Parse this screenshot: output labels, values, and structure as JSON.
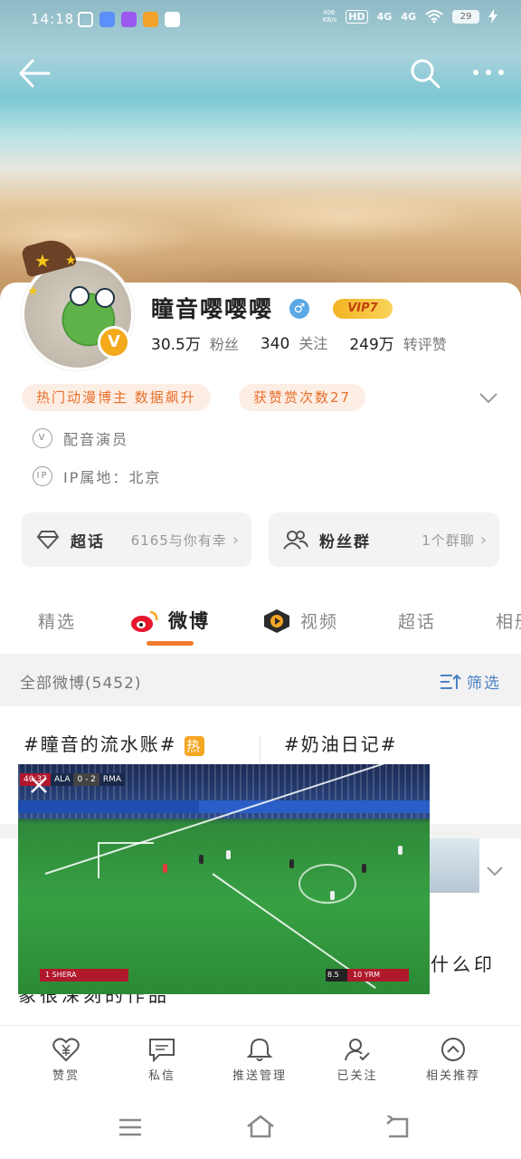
{
  "status_bar": {
    "time": "14:18",
    "network_speed": "406\nKB/s",
    "hd": "HD",
    "sig1": "4G",
    "sig2": "4G",
    "battery": "29"
  },
  "header": {
    "back_icon": "back-arrow-icon",
    "search_icon": "search-icon",
    "more_icon": "more-dots-icon"
  },
  "profile": {
    "name": "瞳音嘤嘤嘤",
    "gender_symbol": "♂",
    "vip_label": "VIP7",
    "verified_badge": "V",
    "stats": [
      {
        "value": "30.5万",
        "label": "粉丝"
      },
      {
        "value": "340",
        "label": "关注"
      },
      {
        "value": "249万",
        "label": "转评赞"
      }
    ],
    "tags": [
      "热门动漫博主 数据飙升",
      "获赞赏次数27"
    ],
    "occupation": "配音演员",
    "ip_label": "IP属地：北京",
    "occupation_icon": "V",
    "ip_icon": "IP"
  },
  "boxes": {
    "chaohua": {
      "title": "超话",
      "subtitle": "6165与你有幸",
      "chevron": "›"
    },
    "fans_group": {
      "title": "粉丝群",
      "subtitle": "1个群聊",
      "chevron": "›"
    }
  },
  "tabs": [
    "精选",
    "微博",
    "视频",
    "超话",
    "相册"
  ],
  "active_tab": "微博",
  "filter": {
    "label": "全部微博(5452)",
    "button": "筛选"
  },
  "topics": [
    {
      "text": "#瞳音的流水账#",
      "badge": "热"
    },
    {
      "text": "#奶油日记#"
    }
  ],
  "post": {
    "text": "天天选，只也并持些些也里神思年业少年有什么印象很深刻的作品"
  },
  "video": {
    "scoreboard": {
      "time": "40:37",
      "team_home": "ALA",
      "score": "0 - 2",
      "team_away": "RMA"
    },
    "left_plate": "1 SHERA",
    "right_plate": "10 YRM",
    "right_num": "8.5"
  },
  "actions": [
    "赞赏",
    "私信",
    "推送管理",
    "已关注",
    "相关推荐"
  ],
  "colors": {
    "accent": "#f07a2b",
    "link": "#4b82c4",
    "tag_bg": "#fdeee5",
    "vip": "#f4b323"
  }
}
